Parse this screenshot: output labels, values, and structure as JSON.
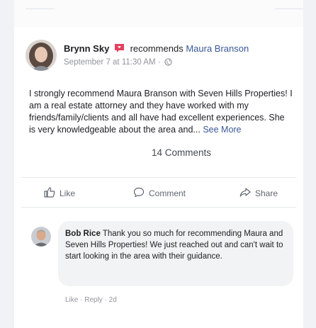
{
  "post": {
    "author": "Brynn Sky",
    "verb": "recommends",
    "page_name": "Maura Branson",
    "timestamp": "September 7 at 11:30 AM ·",
    "body": "I strongly recommend Maura Branson with Seven Hills Properties! I am a real estate attorney and they have worked with my friends/family/clients and all have had excellent experiences. She is very knowledgeable about the area and...",
    "see_more": "See More",
    "comments_count": "14 Comments"
  },
  "actions": {
    "like": "Like",
    "comment": "Comment",
    "share": "Share"
  },
  "comment": {
    "author": "Bob Rice",
    "text": "Thank you so much for recommending Maura and Seven Hills Properties! We just reached out and can't wait to start looking in the area with their guidance.",
    "meta": "Like · Reply · 2d"
  },
  "colors": {
    "link": "#385898",
    "badge": "#e4405f",
    "text": "#1c1e21",
    "muted": "#90949c"
  }
}
